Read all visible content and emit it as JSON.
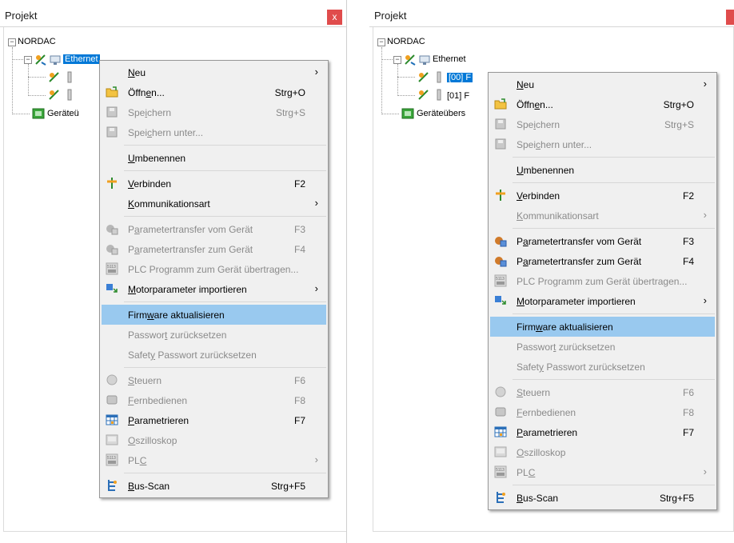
{
  "colors": {
    "selection": "#0078d7",
    "menu_highlight": "#99c9ef",
    "close_button": "#e04c4c"
  },
  "left_panel": {
    "title": "Projekt",
    "close_label": "x",
    "tree": {
      "root": "NORDAC",
      "ethernet": "Ethernet",
      "devices": [
        "",
        ""
      ],
      "overview": "Geräteü"
    }
  },
  "right_panel": {
    "title": "Projekt",
    "tree": {
      "root": "NORDAC",
      "ethernet": "Ethernet",
      "devices": [
        "[00] F",
        "[01] F"
      ],
      "overview": "Geräteübers"
    }
  },
  "menu_left": {
    "items": {
      "neu": {
        "pre": "",
        "u": "N",
        "post": "eu",
        "shortcut": ""
      },
      "oeffnen": {
        "pre": "Öffn",
        "u": "e",
        "post": "n...",
        "shortcut": "Strg+O"
      },
      "speichern": {
        "pre": "Spe",
        "u": "i",
        "post": "chern",
        "shortcut": "Strg+S"
      },
      "speichern_unter": {
        "pre": "Spei",
        "u": "c",
        "post": "hern unter...",
        "shortcut": ""
      },
      "umbenennen": {
        "pre": "",
        "u": "U",
        "post": "mbenennen",
        "shortcut": ""
      },
      "verbinden": {
        "pre": "",
        "u": "V",
        "post": "erbinden",
        "shortcut": "F2"
      },
      "kommunikationsart": {
        "pre": "",
        "u": "K",
        "post": "ommunikationsart",
        "shortcut": ""
      },
      "param_vom": {
        "pre": "P",
        "u": "a",
        "post": "rametertransfer vom Gerät",
        "shortcut": "F3"
      },
      "param_zum": {
        "pre": "P",
        "u": "a",
        "post": "rametertransfer zum Gerät",
        "shortcut": "F4"
      },
      "plc_prog": {
        "pre": "PLC Programm zum Gerät übertragen...",
        "u": "",
        "post": "",
        "shortcut": ""
      },
      "motorparameter": {
        "pre": "",
        "u": "M",
        "post": "otorparameter importieren",
        "shortcut": ""
      },
      "firmware": {
        "pre": "Firm",
        "u": "w",
        "post": "are aktualisieren",
        "shortcut": ""
      },
      "passwort": {
        "pre": "Passwor",
        "u": "t",
        "post": " zurücksetzen",
        "shortcut": ""
      },
      "safety": {
        "pre": "Safet",
        "u": "y",
        "post": " Passwort zurücksetzen",
        "shortcut": ""
      },
      "steuern": {
        "pre": "",
        "u": "S",
        "post": "teuern",
        "shortcut": "F6"
      },
      "fernbedienen": {
        "pre": "",
        "u": "F",
        "post": "ernbedienen",
        "shortcut": "F8"
      },
      "parametrieren": {
        "pre": "",
        "u": "P",
        "post": "arametrieren",
        "shortcut": "F7"
      },
      "oszilloskop": {
        "pre": "",
        "u": "O",
        "post": "szilloskop",
        "shortcut": ""
      },
      "plc": {
        "pre": "PL",
        "u": "C",
        "post": "",
        "shortcut": ""
      },
      "busscan": {
        "pre": "",
        "u": "B",
        "post": "us-Scan",
        "shortcut": "Strg+F5"
      }
    }
  },
  "menu_right": {
    "items": {
      "neu": {
        "pre": "",
        "u": "N",
        "post": "eu",
        "shortcut": ""
      },
      "oeffnen": {
        "pre": "Öffn",
        "u": "e",
        "post": "n...",
        "shortcut": "Strg+O"
      },
      "speichern": {
        "pre": "Spe",
        "u": "i",
        "post": "chern",
        "shortcut": "Strg+S"
      },
      "speichern_unter": {
        "pre": "Spei",
        "u": "c",
        "post": "hern unter...",
        "shortcut": ""
      },
      "umbenennen": {
        "pre": "",
        "u": "U",
        "post": "mbenennen",
        "shortcut": ""
      },
      "verbinden": {
        "pre": "",
        "u": "V",
        "post": "erbinden",
        "shortcut": "F2"
      },
      "kommunikationsart": {
        "pre": "",
        "u": "K",
        "post": "ommunikationsart",
        "shortcut": ""
      },
      "param_vom": {
        "pre": "P",
        "u": "a",
        "post": "rametertransfer vom Gerät",
        "shortcut": "F3"
      },
      "param_zum": {
        "pre": "P",
        "u": "a",
        "post": "rametertransfer zum Gerät",
        "shortcut": "F4"
      },
      "plc_prog": {
        "pre": "PLC Programm zum Gerät übertragen...",
        "u": "",
        "post": "",
        "shortcut": ""
      },
      "motorparameter": {
        "pre": "",
        "u": "M",
        "post": "otorparameter importieren",
        "shortcut": ""
      },
      "firmware": {
        "pre": "Firm",
        "u": "w",
        "post": "are aktualisieren",
        "shortcut": ""
      },
      "passwort": {
        "pre": "Passwor",
        "u": "t",
        "post": " zurücksetzen",
        "shortcut": ""
      },
      "safety": {
        "pre": "Safet",
        "u": "y",
        "post": " Passwort zurücksetzen",
        "shortcut": ""
      },
      "steuern": {
        "pre": "",
        "u": "S",
        "post": "teuern",
        "shortcut": "F6"
      },
      "fernbedienen": {
        "pre": "",
        "u": "F",
        "post": "ernbedienen",
        "shortcut": "F8"
      },
      "parametrieren": {
        "pre": "",
        "u": "P",
        "post": "arametrieren",
        "shortcut": "F7"
      },
      "oszilloskop": {
        "pre": "",
        "u": "O",
        "post": "szilloskop",
        "shortcut": ""
      },
      "plc": {
        "pre": "PL",
        "u": "C",
        "post": "",
        "shortcut": ""
      },
      "busscan": {
        "pre": "",
        "u": "B",
        "post": "us-Scan",
        "shortcut": "Strg+F5"
      }
    }
  }
}
